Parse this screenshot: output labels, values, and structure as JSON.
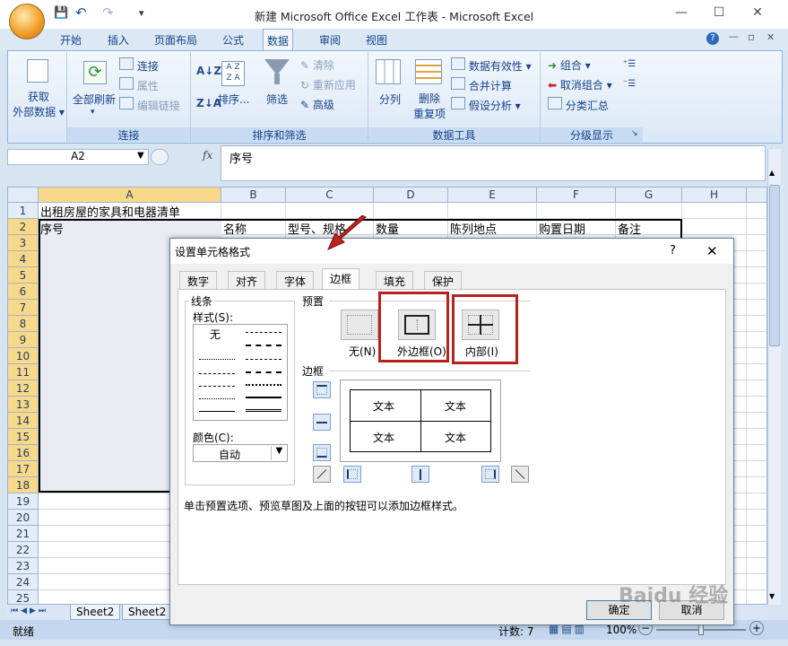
{
  "window": {
    "title": "新建 Microsoft Office Excel 工作表 - Microsoft Excel",
    "minimize": "—",
    "maximize": "☐",
    "close": "✕"
  },
  "quick_access": {
    "save": "💾",
    "undo": "↶",
    "redo": "↷",
    "more": "▾"
  },
  "ribbon": {
    "tabs": [
      "开始",
      "插入",
      "页面布局",
      "公式",
      "数据",
      "审阅",
      "视图"
    ],
    "active_tab": "数据",
    "help": "?",
    "win_controls": [
      "—",
      "▫",
      "✕"
    ],
    "groups": [
      {
        "label": "",
        "buttons": [
          "获取",
          "外部数据"
        ]
      },
      {
        "label": "连接",
        "buttons": [
          "全部刷新",
          "连接",
          "属性",
          "编辑链接"
        ]
      },
      {
        "label": "排序和筛选",
        "buttons": [
          "排序...",
          "筛选",
          "清除",
          "重新应用",
          "高级"
        ]
      },
      {
        "label": "数据工具",
        "buttons": [
          "分列",
          "删除",
          "重复项",
          "数据有效性",
          "合并计算",
          "假设分析"
        ]
      },
      {
        "label": "分级显示",
        "buttons": [
          "组合",
          "取消组合",
          "分类汇总"
        ]
      }
    ]
  },
  "formula_bar": {
    "namebox": "A2",
    "fx": "fx",
    "content": "序号"
  },
  "sheet": {
    "columns": [
      "A",
      "B",
      "C",
      "D",
      "E",
      "F",
      "G",
      "H"
    ],
    "rows": [
      "1",
      "2",
      "3",
      "4",
      "5",
      "6",
      "7",
      "8",
      "9",
      "10",
      "11",
      "12",
      "13",
      "14",
      "15",
      "16",
      "17",
      "18",
      "19",
      "20",
      "21",
      "22",
      "23",
      "24",
      "25"
    ],
    "a1": "出租房屋的家具和电器清单",
    "row2": [
      "序号",
      "名称",
      "型号、规格",
      "数量",
      "陈列地点",
      "购置日期",
      "备注"
    ],
    "tabs": [
      "Sheet2",
      "Sheet2"
    ]
  },
  "status": {
    "ready": "就绪",
    "count": "计数: 7",
    "zoom": "100%"
  },
  "dialog": {
    "title": "设置单元格格式",
    "help": "?",
    "close": "✕",
    "tabs": [
      "数字",
      "对齐",
      "字体",
      "边框",
      "填充",
      "保护"
    ],
    "active_tab": "边框",
    "line_group": "线条",
    "style_label": "样式(S):",
    "style_none": "无",
    "color_label": "颜色(C):",
    "color_value": "自动",
    "preset_label": "预置",
    "preset_none": "无(N)",
    "preset_outline": "外边框(O)",
    "preset_inside": "内部(I)",
    "border_label": "边框",
    "preview_text": [
      "文本",
      "文本",
      "文本",
      "文本"
    ],
    "hint": "单击预置选项、预览草图及上面的按钮可以添加边框样式。",
    "ok": "确定",
    "cancel": "取消"
  },
  "colors": {
    "highlight": "#b3231f",
    "arrow": "#c0241e",
    "accent": "#15428b"
  },
  "watermark": "Baidu 经验"
}
